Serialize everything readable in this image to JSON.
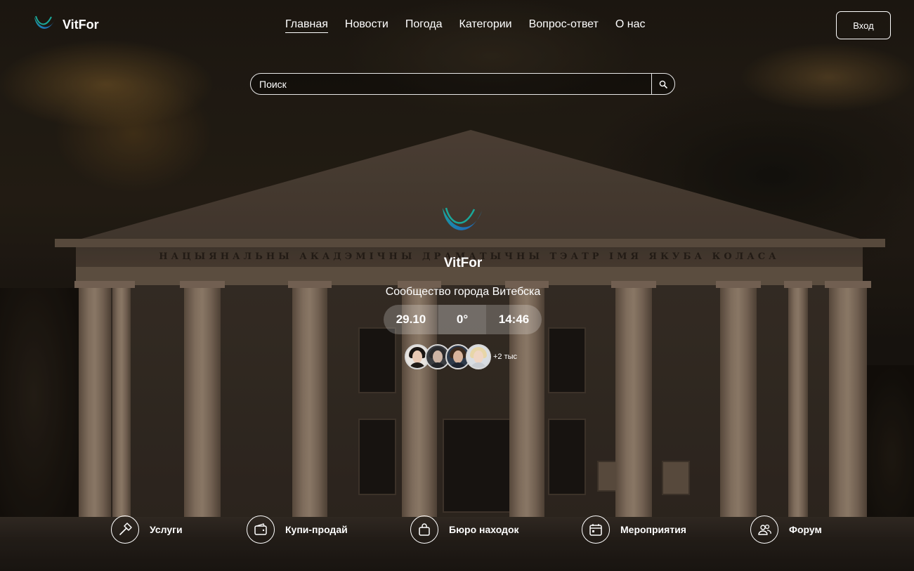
{
  "brand": {
    "name": "VitFor",
    "logo_icon": "vitfor-logo-icon",
    "logo_colors": [
      "#1aa89a",
      "#1f5fbf"
    ]
  },
  "nav": {
    "items": [
      {
        "label": "Главная",
        "active": true
      },
      {
        "label": "Новости"
      },
      {
        "label": "Погода"
      },
      {
        "label": "Категории"
      },
      {
        "label": "Вопрос-ответ"
      },
      {
        "label": "О нас"
      }
    ]
  },
  "auth": {
    "login_label": "Вход"
  },
  "search": {
    "placeholder": "Поиск",
    "button_icon": "search-icon"
  },
  "background": {
    "inscription": "НАЦЫЯНАЛЬНЫ АКАДЭМІЧНЫ ДРАМАТЫЧНЫ ТЭАТР ІМЯ ЯКУБА КОЛАСА"
  },
  "hero": {
    "title": "VitFor",
    "subtitle": "Сообщество города Витебска",
    "date": "29.10",
    "temperature": "0°",
    "time": "14:46",
    "members_extra": "+2 тыс"
  },
  "categories": [
    {
      "label": "Услуги",
      "icon": "hammer-icon"
    },
    {
      "label": "Купи-продай",
      "icon": "wallet-icon"
    },
    {
      "label": "Бюро находок",
      "icon": "bag-icon"
    },
    {
      "label": "Мероприятия",
      "icon": "calendar-icon"
    },
    {
      "label": "Форум",
      "icon": "users-icon"
    }
  ]
}
